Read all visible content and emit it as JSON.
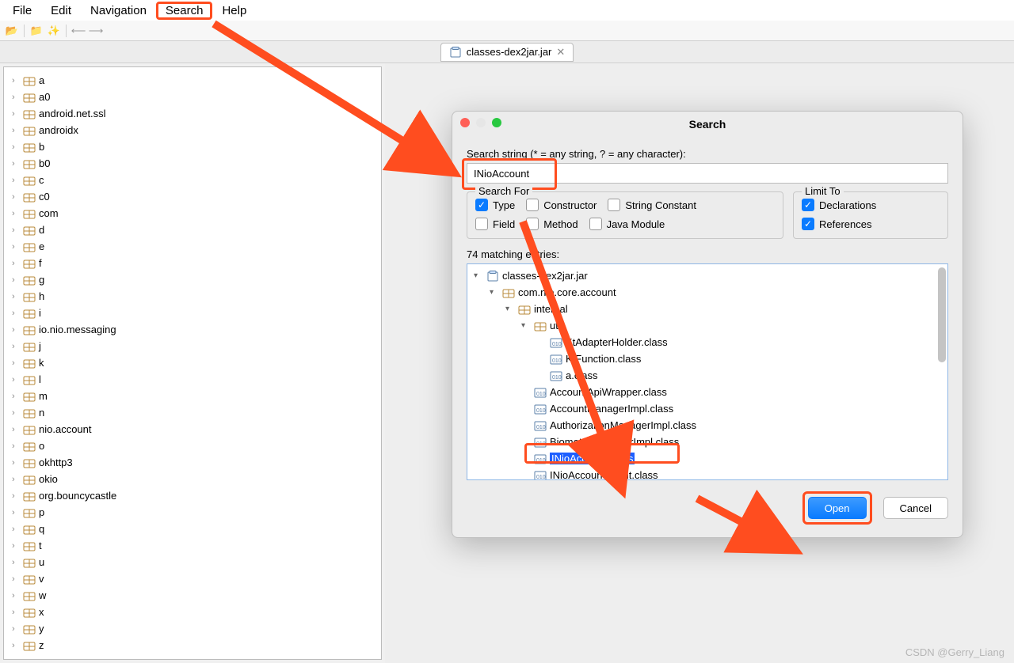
{
  "menubar": {
    "items": [
      "File",
      "Edit",
      "Navigation",
      "Search",
      "Help"
    ],
    "highlighted_index": 3
  },
  "editor_tab": {
    "title": "classes-dex2jar.jar"
  },
  "tree": {
    "items": [
      "a",
      "a0",
      "android.net.ssl",
      "androidx",
      "b",
      "b0",
      "c",
      "c0",
      "com",
      "d",
      "e",
      "f",
      "g",
      "h",
      "i",
      "io.nio.messaging",
      "j",
      "k",
      "l",
      "m",
      "n",
      "nio.account",
      "o",
      "okhttp3",
      "okio",
      "org.bouncycastle",
      "p",
      "q",
      "t",
      "u",
      "v",
      "w",
      "x",
      "y",
      "z"
    ]
  },
  "dialog": {
    "title": "Search",
    "field_label": "Search string (* = any string, ? = any character):",
    "search_value": "INioAccount",
    "search_for": {
      "legend": "Search For",
      "options": [
        {
          "label": "Type",
          "checked": true
        },
        {
          "label": "Constructor",
          "checked": false
        },
        {
          "label": "String Constant",
          "checked": false
        },
        {
          "label": "Field",
          "checked": false
        },
        {
          "label": "Method",
          "checked": false
        },
        {
          "label": "Java Module",
          "checked": false
        }
      ]
    },
    "limit_to": {
      "legend": "Limit To",
      "options": [
        {
          "label": "Declarations",
          "checked": true
        },
        {
          "label": "References",
          "checked": true
        }
      ]
    },
    "match_label": "74 matching entries:",
    "results": {
      "root": "classes-dex2jar.jar",
      "pkg1": "com.nio.core.account",
      "pkg2": "internal",
      "pkg3": "util",
      "util_files": [
        "KtAdapterHolder.class",
        "KtFunction.class",
        "a.class"
      ],
      "internal_files": [
        "AccountApiWrapper.class",
        "AccountManagerImpl.class",
        "AuthorizationManagerImpl.class",
        "BiometricManagerImpl.class",
        "INioAccount.class",
        "INioAccountClient.class"
      ],
      "selected": "INioAccount.class"
    },
    "buttons": {
      "open": "Open",
      "cancel": "Cancel"
    }
  },
  "watermark": "CSDN @Gerry_Liang"
}
